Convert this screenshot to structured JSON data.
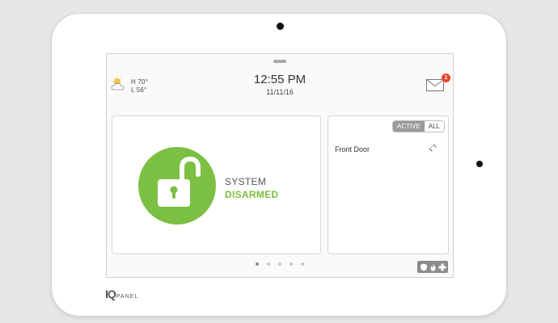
{
  "weather": {
    "icon": "partly-cloudy-icon",
    "high": "H 70°",
    "low": "L 56°"
  },
  "clock": {
    "time": "12:55 PM",
    "date": "11/11/16"
  },
  "messages": {
    "icon": "mail-icon",
    "badge_count": "1"
  },
  "security": {
    "icon": "unlocked-padlock-icon",
    "status_line1": "SYSTEM",
    "status_line2": "DISARMED"
  },
  "sensors": {
    "filters": [
      {
        "label": "ACTIVE",
        "selected": true
      },
      {
        "label": "ALL",
        "selected": false
      }
    ],
    "items": [
      {
        "name": "Front Door",
        "icon": "door-open-icon"
      }
    ]
  },
  "pagination": {
    "total_pages": 5,
    "current_page": 1
  },
  "panic": {
    "icons": [
      "shield-icon",
      "fire-icon",
      "medical-cross-icon"
    ]
  },
  "brand": {
    "mark": "IQ",
    "text": "PANEL"
  },
  "colors": {
    "disarmed_green": "#7cc043",
    "badge_red": "#e8442b",
    "active_tab_gray": "#9a9a9a"
  }
}
